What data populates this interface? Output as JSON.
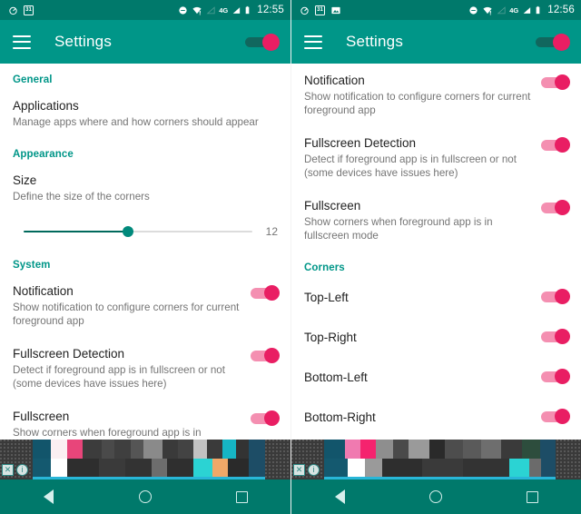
{
  "accent": {
    "app_bar_teal": "#009688",
    "status_bar_teal": "#00796b",
    "section_header_teal": "#009688",
    "toggle_on_pink": "#e91e63",
    "toggle_track_pink": "#f48fb1",
    "slider_active_teal": "#00695c"
  },
  "left": {
    "status": {
      "time": "12:55",
      "left_icons": [
        "alarm-target-icon",
        "calendar-icon"
      ],
      "calendar_day": "31",
      "right_icons": [
        "do-not-disturb-icon",
        "wifi-alert-icon",
        "signal-empty-icon",
        "network-4g-icon",
        "signal-bars-icon",
        "battery-icon"
      ],
      "network_label": "4G"
    },
    "appbar": {
      "menu_icon": "hamburger-menu-icon",
      "title": "Settings",
      "master_switch_on": true
    },
    "sections": [
      {
        "header": "General",
        "rows": [
          {
            "type": "text",
            "title": "Applications",
            "subtitle": "Manage apps where and how corners should appear"
          }
        ]
      },
      {
        "header": "Appearance",
        "rows": [
          {
            "type": "text",
            "title": "Size",
            "subtitle": "Define the size of the corners"
          },
          {
            "type": "slider",
            "value": "12",
            "percent": 48
          }
        ]
      },
      {
        "header": "System",
        "rows": [
          {
            "type": "switch",
            "title": "Notification",
            "subtitle": "Show notification to configure corners for current foreground app",
            "on": true
          },
          {
            "type": "switch",
            "title": "Fullscreen Detection",
            "subtitle": "Detect if foreground app is in fullscreen or not (some devices have issues here)",
            "on": true
          },
          {
            "type": "switch",
            "title": "Fullscreen",
            "subtitle": "Show corners when foreground app is in fullscreen",
            "on": true
          }
        ]
      }
    ],
    "banner": {
      "close_label": "✕",
      "info_label": "i",
      "cells": [
        {
          "color": "#12556b",
          "width": 7
        },
        {
          "color": "#fbeff2",
          "width": 6
        },
        {
          "color": "#e8457a",
          "width": 6
        },
        {
          "color": "#3c3c3c",
          "width": 7
        },
        {
          "color": "#4a4a4a",
          "width": 5
        },
        {
          "color": "#3f3f3f",
          "width": 6
        },
        {
          "color": "#555555",
          "width": 5
        },
        {
          "color": "#8a8a8a",
          "width": 7
        },
        {
          "color": "#3a3a3a",
          "width": 6
        },
        {
          "color": "#434343",
          "width": 6
        },
        {
          "color": "#c2c2c2",
          "width": 5
        },
        {
          "color": "#3a3a3a",
          "width": 6
        },
        {
          "color": "#16b5c4",
          "width": 5
        },
        {
          "color": "#333333",
          "width": 5
        },
        {
          "color": "#1d4d66",
          "width": 6
        }
      ],
      "cells2": [
        {
          "color": "#14596f",
          "width": 7
        },
        {
          "color": "#ffffff",
          "width": 6
        },
        {
          "color": "#2e2e2e",
          "width": 12
        },
        {
          "color": "#3a3a3a",
          "width": 10
        },
        {
          "color": "#333333",
          "width": 10
        },
        {
          "color": "#6d6d6d",
          "width": 6
        },
        {
          "color": "#2f2f2f",
          "width": 10
        },
        {
          "color": "#2bd3d3",
          "width": 7
        },
        {
          "color": "#f0a868",
          "width": 6
        },
        {
          "color": "#2a2a2a",
          "width": 8
        },
        {
          "color": "#1d4d66",
          "width": 6
        }
      ]
    },
    "navbar": {
      "back": "back-icon",
      "home": "home-icon",
      "recents": "recents-icon"
    }
  },
  "right": {
    "status": {
      "time": "12:56",
      "left_icons": [
        "alarm-target-icon",
        "calendar-icon",
        "image-icon"
      ],
      "calendar_day": "31",
      "right_icons": [
        "do-not-disturb-icon",
        "wifi-alert-icon",
        "signal-empty-icon",
        "network-4g-icon",
        "signal-bars-icon",
        "battery-icon"
      ],
      "network_label": "4G"
    },
    "appbar": {
      "menu_icon": "hamburger-menu-icon",
      "title": "Settings",
      "master_switch_on": true
    },
    "sections": [
      {
        "header": "",
        "rows": [
          {
            "type": "switch",
            "title": "Notification",
            "subtitle": "Show notification to configure corners for current foreground app",
            "on": true
          },
          {
            "type": "switch",
            "title": "Fullscreen Detection",
            "subtitle": "Detect if foreground app is in fullscreen or not (some devices have issues here)",
            "on": true
          },
          {
            "type": "switch",
            "title": "Fullscreen",
            "subtitle": "Show corners when foreground app is in fullscreen mode",
            "on": true
          }
        ]
      },
      {
        "header": "Corners",
        "rows": [
          {
            "type": "switch-simple",
            "title": "Top-Left",
            "on": true
          },
          {
            "type": "switch-simple",
            "title": "Top-Right",
            "on": true
          },
          {
            "type": "switch-simple",
            "title": "Bottom-Left",
            "on": true
          },
          {
            "type": "switch-simple",
            "title": "Bottom-Right",
            "on": true
          }
        ]
      }
    ],
    "banner": {
      "close_label": "✕",
      "info_label": "i",
      "cells": [
        {
          "color": "#12556b",
          "width": 8
        },
        {
          "color": "#f07ab0",
          "width": 6
        },
        {
          "color": "#f5236e",
          "width": 6
        },
        {
          "color": "#8e8e8e",
          "width": 7
        },
        {
          "color": "#4a4a4a",
          "width": 6
        },
        {
          "color": "#9a9a9a",
          "width": 8
        },
        {
          "color": "#2a2a2a",
          "width": 6
        },
        {
          "color": "#4d4d4d",
          "width": 7
        },
        {
          "color": "#5a5a5a",
          "width": 7
        },
        {
          "color": "#6e6e6e",
          "width": 8
        },
        {
          "color": "#3a3a3a",
          "width": 8
        },
        {
          "color": "#2d4d3d",
          "width": 7
        },
        {
          "color": "#1d4d66",
          "width": 6
        }
      ],
      "cells2": [
        {
          "color": "#14596f",
          "width": 8
        },
        {
          "color": "#ffffff",
          "width": 6
        },
        {
          "color": "#9a9a9a",
          "width": 6
        },
        {
          "color": "#2e2e2e",
          "width": 14
        },
        {
          "color": "#3a3a3a",
          "width": 14
        },
        {
          "color": "#333333",
          "width": 16
        },
        {
          "color": "#2bd3d3",
          "width": 7
        },
        {
          "color": "#6b6b6b",
          "width": 4
        },
        {
          "color": "#1d4d66",
          "width": 5
        }
      ]
    },
    "navbar": {
      "back": "back-icon",
      "home": "home-icon",
      "recents": "recents-icon"
    }
  }
}
